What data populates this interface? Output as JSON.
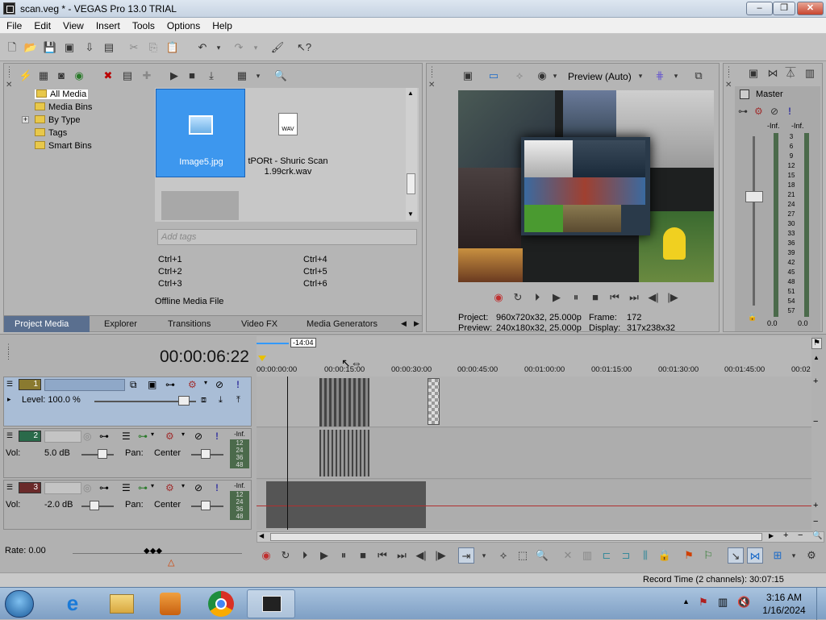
{
  "window": {
    "title": "scan.veg * - VEGAS Pro 13.0 TRIAL",
    "min": "–",
    "max": "❐",
    "close": "✕"
  },
  "menu": [
    "File",
    "Edit",
    "View",
    "Insert",
    "Tools",
    "Options",
    "Help"
  ],
  "media": {
    "tree": [
      "All Media",
      "Media Bins",
      "By Type",
      "Tags",
      "Smart Bins"
    ],
    "expand_glyph": "+",
    "items": [
      {
        "label": "Image5.jpg"
      },
      {
        "label": "tPORt - Shuric Scan 1.99crk.wav"
      }
    ],
    "wav_badge": "WAV",
    "tags_placeholder": "Add tags",
    "shortcuts": [
      "Ctrl+1",
      "Ctrl+4",
      "Ctrl+2",
      "Ctrl+5",
      "Ctrl+3",
      "Ctrl+6"
    ],
    "status": "Offline Media File",
    "tabs": [
      "Project Media",
      "Explorer",
      "Transitions",
      "Video FX",
      "Media Generators"
    ]
  },
  "preview": {
    "mode": "Preview (Auto)",
    "project_label": "Project:",
    "project_value": "960x720x32, 25.000p",
    "frame_label": "Frame:",
    "frame_value": "172",
    "preview_label": "Preview:",
    "preview_value": "240x180x32, 25.000p",
    "display_label": "Display:",
    "display_value": "317x238x32"
  },
  "master": {
    "title": "Master",
    "inf_left": "-Inf.",
    "inf_right": "-Inf.",
    "scale": [
      "3",
      "6",
      "9",
      "12",
      "15",
      "18",
      "21",
      "24",
      "27",
      "30",
      "33",
      "36",
      "39",
      "42",
      "45",
      "48",
      "51",
      "54",
      "57"
    ],
    "val_left": "0.0",
    "val_right": "0.0"
  },
  "timeline": {
    "timecode": "00:00:06:22",
    "marker": "-14:04",
    "ruler": [
      "00:00:00:00",
      "00:00:15:00",
      "00:00:30:00",
      "00:00:45:00",
      "00:01:00:00",
      "00:01:15:00",
      "00:01:30:00",
      "00:01:45:00",
      "00:02"
    ],
    "tracks": [
      {
        "num": "1",
        "label": "Level: 100.0 %",
        "type": "video"
      },
      {
        "num": "2",
        "vol_label": "Vol:",
        "vol": "5.0 dB",
        "pan_label": "Pan:",
        "pan": "Center",
        "type": "audio",
        "meter": [
          "-Inf.",
          "12",
          "24",
          "36",
          "48"
        ]
      },
      {
        "num": "3",
        "vol_label": "Vol:",
        "vol": "-2.0 dB",
        "pan_label": "Pan:",
        "pan": "Center",
        "type": "audio",
        "meter": [
          "-Inf.",
          "12",
          "24",
          "36",
          "48"
        ]
      }
    ],
    "rate": "Rate: 0.00",
    "record_time": "Record Time (2 channels): 30:07:15"
  },
  "taskbar": {
    "time": "3:16 AM",
    "date": "1/16/2024"
  },
  "colors": {
    "accent": "#3399ff",
    "selected_media": "#3d97ee",
    "track3_icon": "#6a2a2a",
    "track2_icon": "#2a6a4a"
  }
}
